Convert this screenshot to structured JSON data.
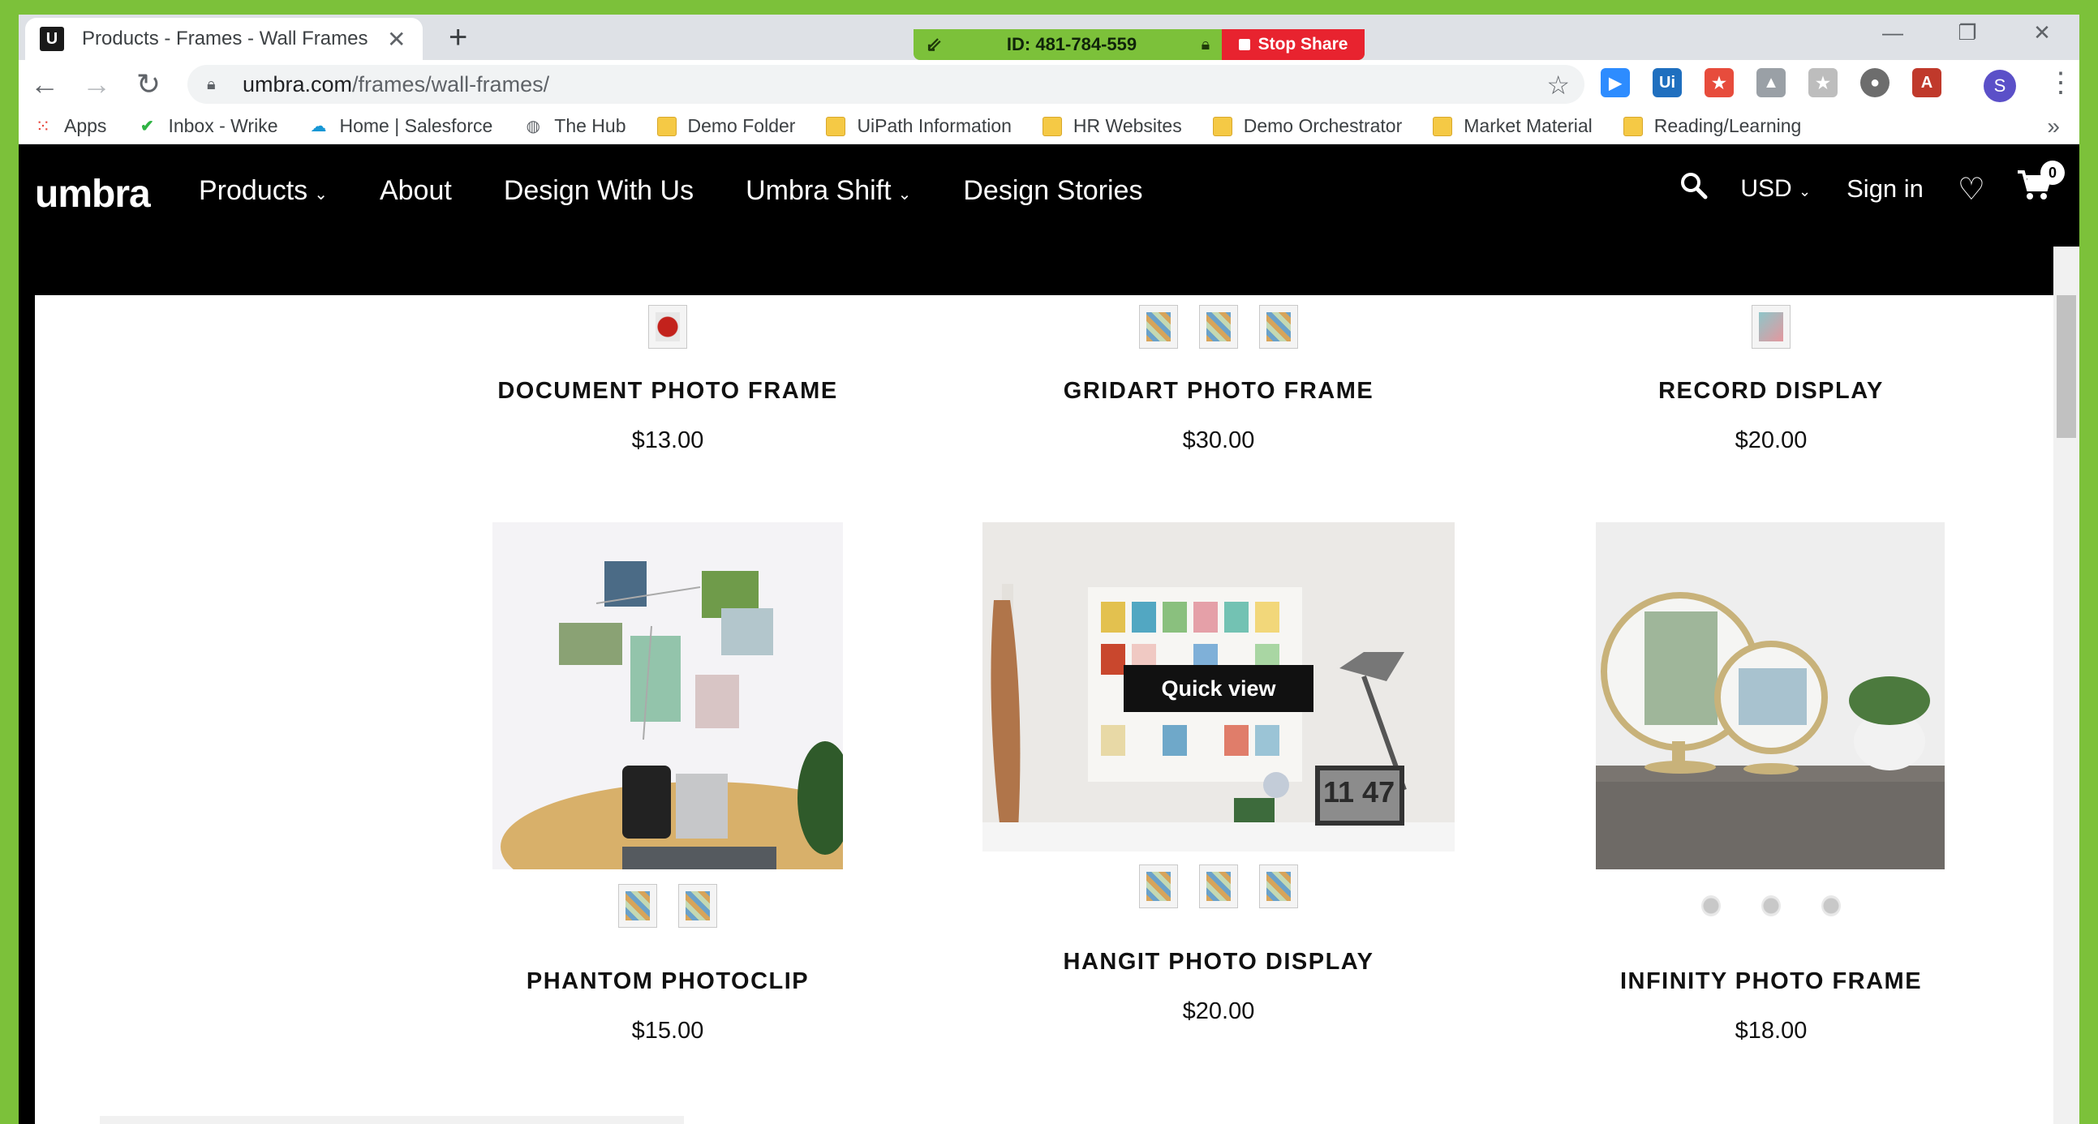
{
  "browser": {
    "tab_title": "Products - Frames - Wall Frames",
    "new_tab": "+",
    "url_domain": "umbra.com",
    "url_path": "/frames/wall-frames/",
    "profile_initial": "S",
    "window_controls": [
      "—",
      "❐",
      "✕"
    ]
  },
  "share_bar": {
    "id_text": "ID: 481-784-559",
    "stop_label": "Stop Share"
  },
  "bookmarks": [
    {
      "label": "Apps",
      "icon": "apps-grid-icon"
    },
    {
      "label": "Inbox - Wrike",
      "icon": "wrike-check-icon"
    },
    {
      "label": "Home | Salesforce",
      "icon": "salesforce-cloud-icon"
    },
    {
      "label": "The Hub",
      "icon": "globe-icon"
    },
    {
      "label": "Demo Folder",
      "icon": "folder-icon"
    },
    {
      "label": "UiPath Information",
      "icon": "folder-icon"
    },
    {
      "label": "HR Websites",
      "icon": "folder-icon"
    },
    {
      "label": "Demo Orchestrator",
      "icon": "folder-icon"
    },
    {
      "label": "Market Material",
      "icon": "folder-icon"
    },
    {
      "label": "Reading/Learning",
      "icon": "folder-icon"
    }
  ],
  "site": {
    "logo": "umbra",
    "nav": {
      "products": "Products",
      "about": "About",
      "design_with_us": "Design With Us",
      "umbra_shift": "Umbra Shift",
      "design_stories": "Design Stories"
    },
    "currency": "USD",
    "sign_in": "Sign in",
    "cart_count": "0"
  },
  "products": {
    "document": {
      "name": "DOCUMENT PHOTO FRAME",
      "price": "$13.00"
    },
    "gridart": {
      "name": "GRIDART PHOTO FRAME",
      "price": "$30.00"
    },
    "record": {
      "name": "RECORD DISPLAY",
      "price": "$20.00"
    },
    "phantom": {
      "name": "PHANTOM PHOTOCLIP",
      "price": "$15.00"
    },
    "hangit": {
      "name": "HANGIT PHOTO DISPLAY",
      "price": "$20.00",
      "quick_view": "Quick view",
      "clock_text": "11 47"
    },
    "infinity": {
      "name": "INFINITY PHOTO FRAME",
      "price": "$18.00"
    }
  },
  "colors": {
    "share_green": "#7cc13a",
    "stop_red": "#e8232f",
    "header_black": "#000000"
  }
}
